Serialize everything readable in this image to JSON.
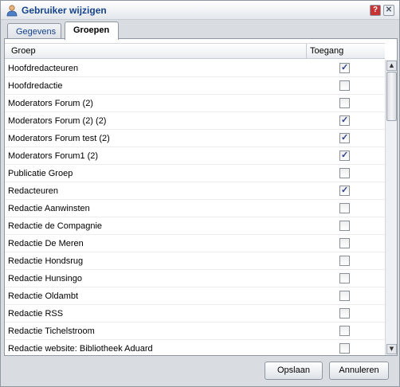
{
  "window": {
    "title": "Gebruiker wijzigen",
    "help_label": "?",
    "close_label": "✕"
  },
  "tabs": [
    {
      "label": "Gegevens",
      "active": false
    },
    {
      "label": "Groepen",
      "active": true
    }
  ],
  "grid": {
    "columns": [
      "Groep",
      "Toegang"
    ],
    "rows": [
      {
        "name": "Hoofdredacteuren",
        "checked": true
      },
      {
        "name": "Hoofdredactie",
        "checked": false
      },
      {
        "name": "Moderators Forum (2)",
        "checked": false
      },
      {
        "name": "Moderators Forum (2) (2)",
        "checked": true
      },
      {
        "name": "Moderators Forum test (2)",
        "checked": true
      },
      {
        "name": "Moderators Forum1 (2)",
        "checked": true
      },
      {
        "name": "Publicatie Groep",
        "checked": false
      },
      {
        "name": "Redacteuren",
        "checked": true
      },
      {
        "name": "Redactie Aanwinsten",
        "checked": false
      },
      {
        "name": "Redactie de Compagnie",
        "checked": false
      },
      {
        "name": "Redactie De Meren",
        "checked": false
      },
      {
        "name": "Redactie Hondsrug",
        "checked": false
      },
      {
        "name": "Redactie Hunsingo",
        "checked": false
      },
      {
        "name": "Redactie Oldambt",
        "checked": false
      },
      {
        "name": "Redactie RSS",
        "checked": false
      },
      {
        "name": "Redactie Tichelstroom",
        "checked": false
      },
      {
        "name": "Redactie website: Bibliotheek Aduard",
        "checked": false
      }
    ]
  },
  "buttons": {
    "save": "Opslaan",
    "cancel": "Annuleren"
  }
}
